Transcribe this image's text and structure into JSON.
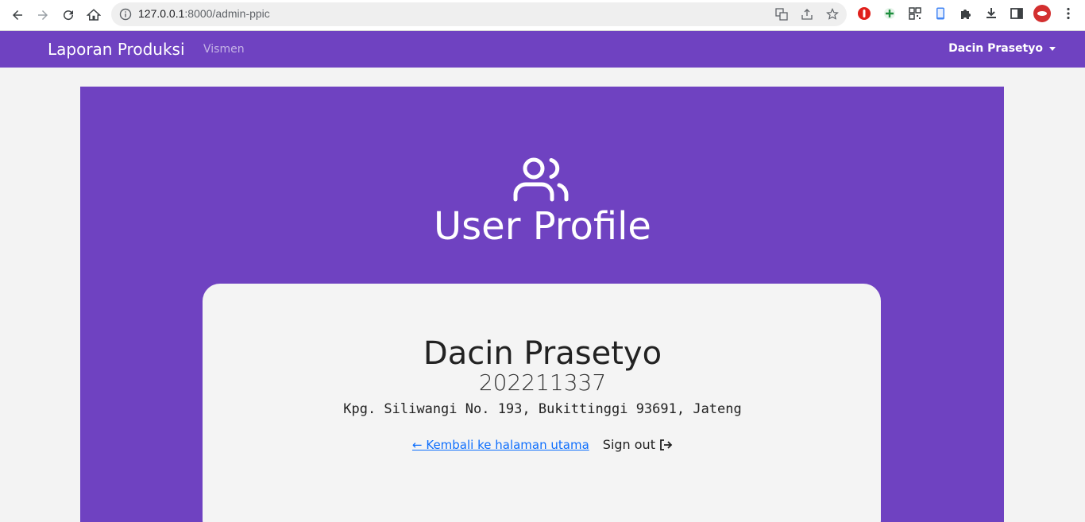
{
  "browser": {
    "url_host": "127.0.0.1",
    "url_path": ":8000/admin-ppic"
  },
  "navbar": {
    "brand": "Laporan Produksi",
    "link": "Vismen",
    "user": "Dacin Prasetyo"
  },
  "hero": {
    "title": "User Profile",
    "icon": "users-icon"
  },
  "profile": {
    "name": "Dacin Prasetyo",
    "id": "202211337",
    "address": "Kpg. Siliwangi No. 193, Bukittinggi 93691, Jateng",
    "back_link": "← Kembali ke halaman utama",
    "signout": "Sign out"
  },
  "colors": {
    "primary": "#6f42c1",
    "link": "#0d6efd",
    "card": "#f4f4f4"
  }
}
